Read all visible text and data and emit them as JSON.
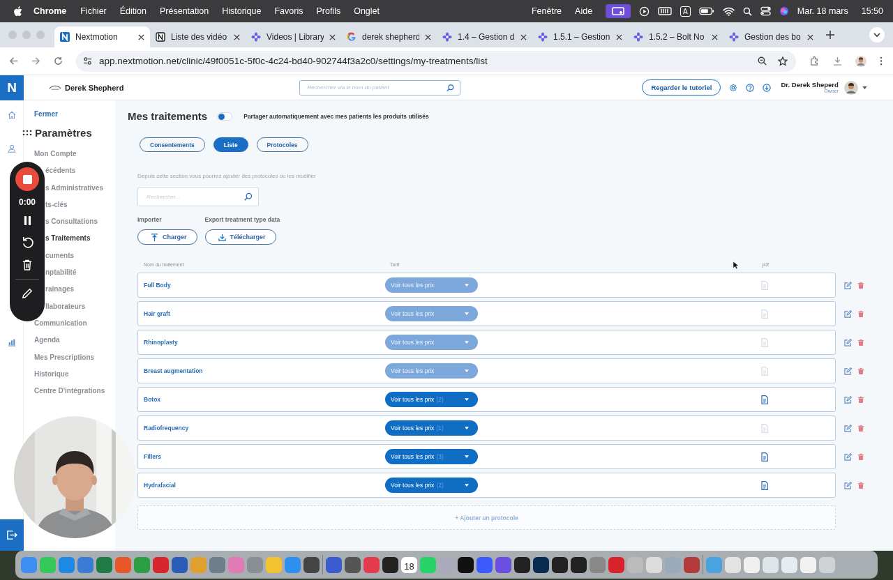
{
  "menu_bar": {
    "app": "Chrome",
    "menus": [
      "Fichier",
      "Édition",
      "Présentation",
      "Historique",
      "Favoris",
      "Profils",
      "Onglet"
    ],
    "right_menus": [
      "Fenêtre",
      "Aide"
    ],
    "input_source": "A",
    "date": "Mar. 18 mars",
    "time": "15:50"
  },
  "browser": {
    "tabs": [
      {
        "title": "Nextmotion",
        "kind": "nextmotion",
        "selected": true
      },
      {
        "title": "Liste des vidéo",
        "kind": "notion",
        "selected": false
      },
      {
        "title": "Videos | Library",
        "kind": "flower",
        "selected": false
      },
      {
        "title": "derek shepherd",
        "kind": "google",
        "selected": false
      },
      {
        "title": "1.4 – Gestion d",
        "kind": "flower",
        "selected": false
      },
      {
        "title": "1.5.1 – Gestion",
        "kind": "flower",
        "selected": false
      },
      {
        "title": "1.5.2 – Bolt No",
        "kind": "flower",
        "selected": false
      },
      {
        "title": "Gestion des bo",
        "kind": "flower",
        "selected": false
      }
    ],
    "url": "app.nextmotion.net/clinic/49f0051c-5f0c-4c24-bd40-902744f3a2c0/settings/my-treatments/list"
  },
  "header": {
    "logo": "N",
    "clinic": "Derek Shepherd",
    "search_placeholder": "Rechercher via le nom du patient",
    "tutorial_button": "Regarder le tutoriel",
    "user_name": "Dr. Derek Sheperd",
    "user_role": "Owner"
  },
  "sidebar": {
    "close": "Fermer",
    "title": "Paramètres",
    "items": [
      {
        "label": "Mon Compte",
        "selected": false
      },
      {
        "label": "écédents",
        "selected": false
      },
      {
        "label": "s Administratives",
        "selected": false
      },
      {
        "label": "ts-clés",
        "selected": false
      },
      {
        "label": "s Consultations",
        "selected": false
      },
      {
        "label": "s Traitements",
        "selected": true
      },
      {
        "label": "cuments",
        "selected": false
      },
      {
        "label": "nptabilité",
        "selected": false
      },
      {
        "label": "rainages",
        "selected": false
      },
      {
        "label": "llaborateurs",
        "selected": false
      },
      {
        "label": "Communication",
        "selected": false
      },
      {
        "label": "Agenda",
        "selected": false
      },
      {
        "label": "Mes Prescriptions",
        "selected": false
      },
      {
        "label": "Historique",
        "selected": false
      },
      {
        "label": "Centre D'intégrations",
        "selected": false
      }
    ]
  },
  "recorder": {
    "timer": "0:00"
  },
  "page": {
    "title": "Mes traitements",
    "share_toggle": {
      "on": false,
      "label": "Partager automatiquement avec mes patients les produits utilisés"
    },
    "tabs": [
      {
        "label": "Consentements",
        "selected": false
      },
      {
        "label": "Liste",
        "selected": true
      },
      {
        "label": "Protocoles",
        "selected": false
      }
    ],
    "description": "Depuis cette section vous pourrez ajouter des protocoles ou les modifier",
    "search": {
      "placeholder": "Rechercher..."
    },
    "import": {
      "label": "Importer",
      "button": "Charger"
    },
    "export": {
      "label": "Export treatment type data",
      "button": "Télécharger"
    },
    "columns": [
      "Nom du traitement",
      "Tarif",
      "pdf"
    ],
    "rows": [
      {
        "name": "Full Body",
        "price_button": "Voir tous les prix",
        "enabled": false,
        "has_pdf": false
      },
      {
        "name": "Hair graft",
        "price_button": "Voir tous les prix",
        "enabled": false,
        "has_pdf": false
      },
      {
        "name": "Rhinoplasty",
        "price_button": "Voir tous les prix",
        "enabled": false,
        "has_pdf": false
      },
      {
        "name": "Breast augmentation",
        "price_button": "Voir tous les prix",
        "enabled": false,
        "has_pdf": false
      },
      {
        "name": "Botox",
        "price_button": "Voir tous les prix",
        "count": "(2)",
        "enabled": true,
        "has_pdf": true
      },
      {
        "name": "Radiofrequency",
        "price_button": "Voir tous les prix",
        "count": "(1)",
        "enabled": true,
        "has_pdf": false
      },
      {
        "name": "Fillers",
        "price_button": "Voir tous les prix",
        "count": "(3)",
        "enabled": true,
        "has_pdf": true
      },
      {
        "name": "Hydrafacial",
        "price_button": "Voir tous les prix",
        "count": "(2)",
        "enabled": true,
        "has_pdf": true
      }
    ],
    "add_button": "+ Ajouter un protocole"
  },
  "dock": {
    "calendar_day": "18"
  }
}
